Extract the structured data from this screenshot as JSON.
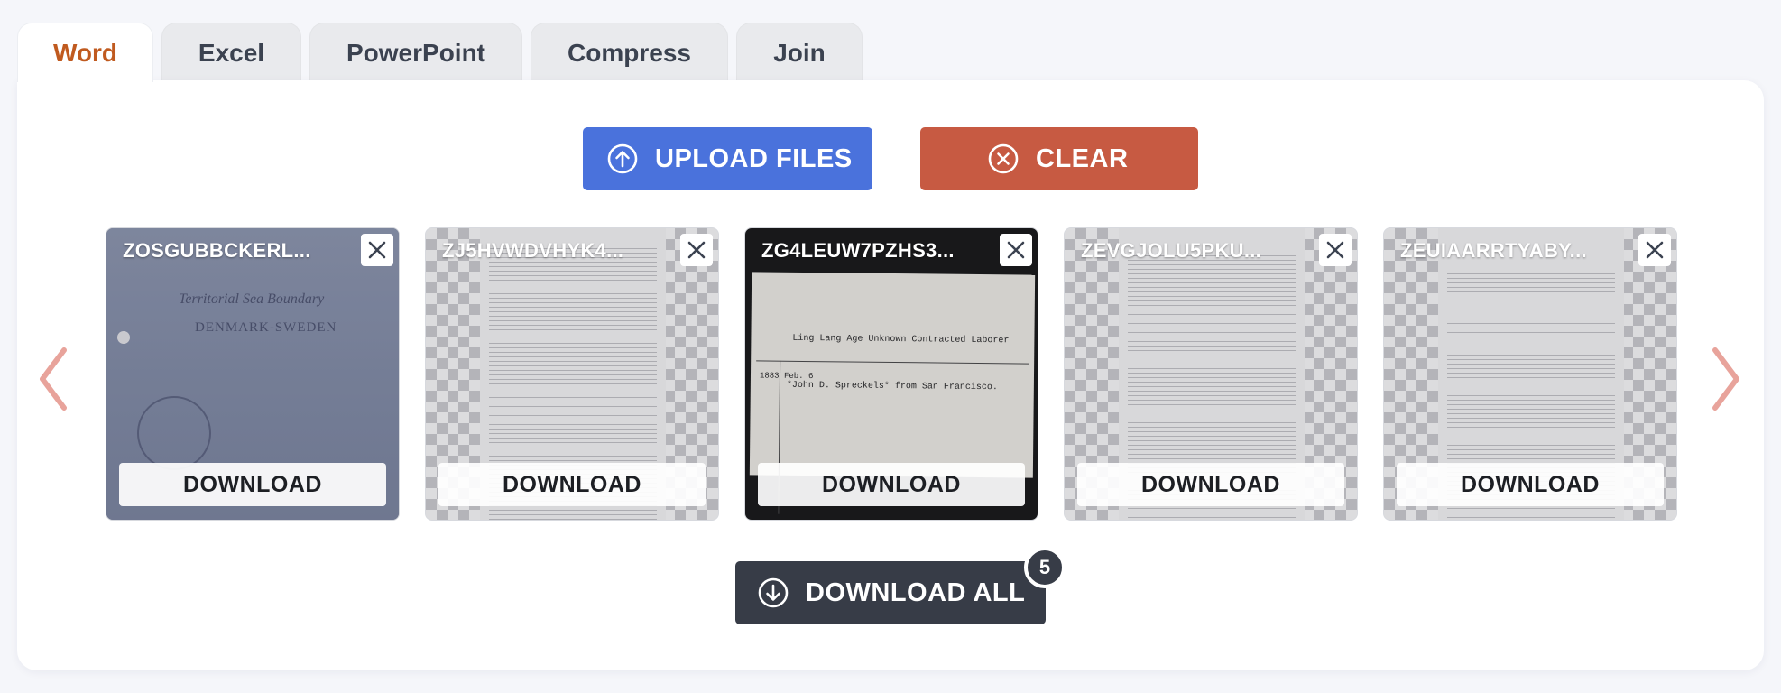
{
  "tabs": [
    {
      "label": "Word",
      "active": true
    },
    {
      "label": "Excel",
      "active": false
    },
    {
      "label": "PowerPoint",
      "active": false
    },
    {
      "label": "Compress",
      "active": false
    },
    {
      "label": "Join",
      "active": false
    }
  ],
  "actions": {
    "upload_label": "UPLOAD FILES",
    "upload_icon": "arrow-up-circle-icon",
    "clear_label": "CLEAR",
    "clear_icon": "x-circle-icon"
  },
  "files": [
    {
      "name": "ZOSGUBBCKERL...",
      "download_label": "DOWNLOAD",
      "preview": "photo",
      "preview_text": [
        "Territorial Sea Boundary",
        "DENMARK-SWEDEN"
      ]
    },
    {
      "name": "ZJ5HVWDVHYK4...",
      "download_label": "DOWNLOAD",
      "preview": "document"
    },
    {
      "name": "ZG4LEUW7PZHS3...",
      "download_label": "DOWNLOAD",
      "preview": "scan",
      "preview_text": [
        "Ling Lang  Age Unknown  Contracted Laborer",
        "*John D. Spreckels*    from    San Francisco.",
        "1883 Feb. 6"
      ]
    },
    {
      "name": "ZEVGJOLU5PKU...",
      "download_label": "DOWNLOAD",
      "preview": "document"
    },
    {
      "name": "ZEUIAARRTYABY...",
      "download_label": "DOWNLOAD",
      "preview": "document"
    }
  ],
  "download_all": {
    "label": "DOWNLOAD ALL",
    "count": "5",
    "icon": "arrow-down-circle-icon"
  },
  "colors": {
    "accent_tab": "#c05a1f",
    "upload": "#4a72dc",
    "clear": "#c75a42",
    "download_all": "#373c47",
    "arrow": "#e8a39b"
  }
}
